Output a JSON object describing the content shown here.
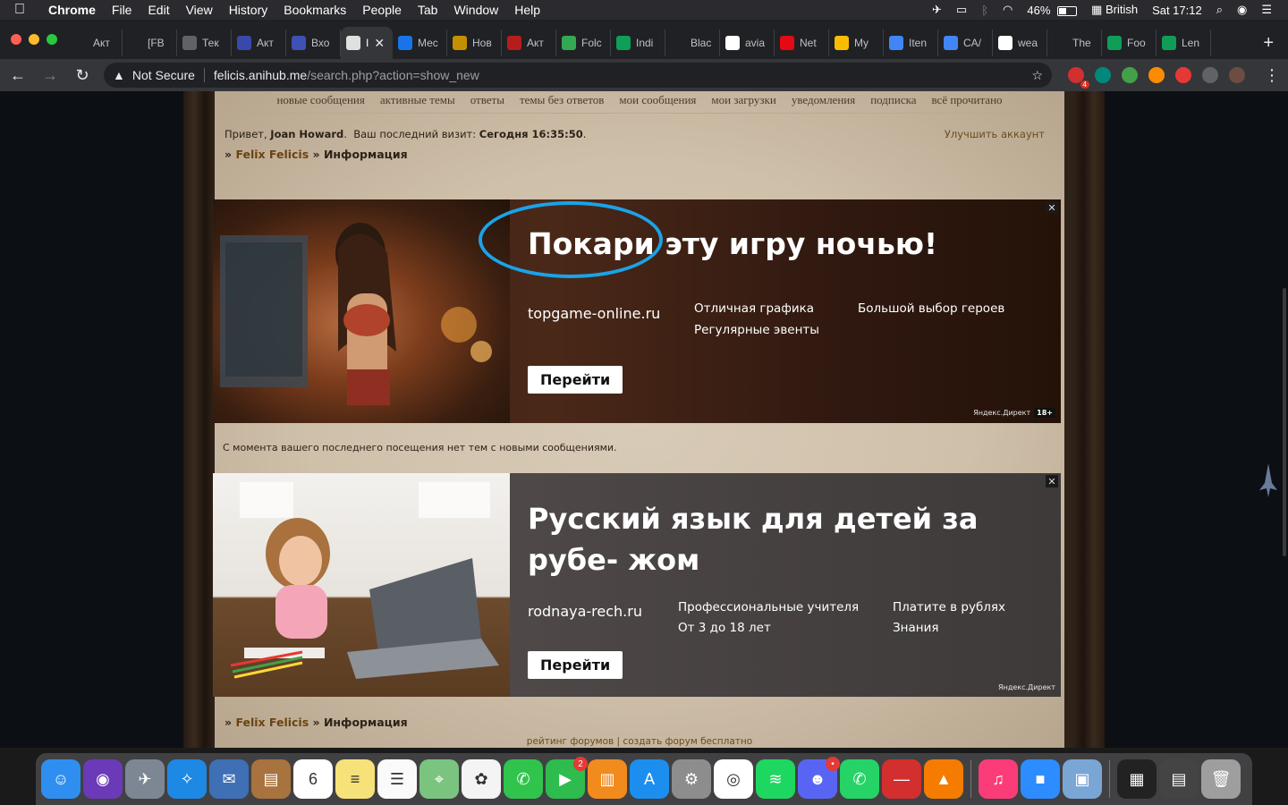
{
  "menubar": {
    "app": "Chrome",
    "items": [
      "File",
      "Edit",
      "View",
      "History",
      "Bookmarks",
      "People",
      "Tab",
      "Window",
      "Help"
    ],
    "battery": "46%",
    "battery_level": 0.46,
    "input_source": "British",
    "clock": "Sat 17:12"
  },
  "tabs": [
    {
      "label": "Акт",
      "icon": "star-icon",
      "color": "#202124"
    },
    {
      "label": "[FB",
      "icon": "star-icon",
      "color": "#202124"
    },
    {
      "label": "Тек",
      "icon": "globe-icon",
      "color": "#5f6368"
    },
    {
      "label": "Акт",
      "icon": "globe-icon",
      "color": "#3949ab"
    },
    {
      "label": "Вхо",
      "icon": "mail-icon",
      "color": "#3f51b5"
    },
    {
      "label": "I",
      "icon": "ghost-icon",
      "color": "#e0e0e0",
      "active": true
    },
    {
      "label": "Мес",
      "icon": "chat-icon",
      "color": "#1a73e8"
    },
    {
      "label": "Нов",
      "icon": "h-icon",
      "color": "#c49000"
    },
    {
      "label": "Акт",
      "icon": "flag-icon",
      "color": "#b71c1c"
    },
    {
      "label": "Folc",
      "icon": "drive-icon",
      "color": "#34a853"
    },
    {
      "label": "Indi",
      "icon": "sheets-icon",
      "color": "#0f9d58"
    },
    {
      "label": "Blac",
      "icon": "moon-icon",
      "color": "#202124"
    },
    {
      "label": "avia",
      "icon": "google-icon",
      "color": "#ffffff"
    },
    {
      "label": "Net",
      "icon": "netflix-icon",
      "color": "#e50914"
    },
    {
      "label": "My",
      "icon": "drive-icon",
      "color": "#fbbc04"
    },
    {
      "label": "Iten",
      "icon": "docs-icon",
      "color": "#4285f4"
    },
    {
      "label": "CA/",
      "icon": "docs-icon",
      "color": "#4285f4"
    },
    {
      "label": "wea",
      "icon": "google-icon",
      "color": "#ffffff"
    },
    {
      "label": "The",
      "icon": "nyt-icon",
      "color": "#202124"
    },
    {
      "label": "Foo",
      "icon": "sheets-icon",
      "color": "#0f9d58"
    },
    {
      "label": "Len",
      "icon": "sheets-icon",
      "color": "#0f9d58"
    }
  ],
  "address": {
    "security": "Not Secure",
    "host": "felicis.anihub.me",
    "path": "/search.php?action=show_new"
  },
  "extensions": [
    {
      "icon": "extension-red-icon",
      "color": "#d32f2f",
      "badge": "4"
    },
    {
      "icon": "extension-e-icon",
      "color": "#00897b",
      "badge": ""
    },
    {
      "icon": "extension-green-icon",
      "color": "#43a047",
      "badge": ""
    },
    {
      "icon": "extension-wrench-icon",
      "color": "#fb8c00",
      "badge": ""
    },
    {
      "icon": "extension-red2-icon",
      "color": "#e53935",
      "badge": ""
    },
    {
      "icon": "puzzle-icon",
      "color": "#5f6368",
      "badge": ""
    },
    {
      "icon": "profile-avatar-icon",
      "color": "#6d4c41",
      "badge": ""
    }
  ],
  "forum": {
    "nav": [
      "новые сообщения",
      "активные темы",
      "ответы",
      "темы без ответов",
      "мои сообщения",
      "мои загрузки",
      "уведомления",
      "подписка",
      "всё прочитано"
    ],
    "greet_prefix": "Привет,",
    "user": "Joan Howard",
    "last_visit_label": "Ваш последний визит:",
    "last_visit": "Сегодня 16:35:50",
    "upgrade": "Улучшить аккаунт",
    "crumb_sep": "»",
    "crumb_forum": "Felix Felicis",
    "crumb_page": "Информация",
    "notice": "С момента вашего последнего посещения нет тем с новыми сообщениями.",
    "footer": "рейтинг форумов | создать форум бесплатно"
  },
  "ad1": {
    "headline": "Покари эту игру ночью!",
    "domain": "topgame-online.ru",
    "features": [
      "Отличная графика",
      "Регулярные эвенты",
      "Большой выбор героев"
    ],
    "button": "Перейти",
    "brand": "Яндекс.Директ",
    "age": "18+"
  },
  "ad2": {
    "headline": "Русский язык для детей за рубе- жом",
    "domain": "rodnaya-rech.ru",
    "features": [
      "Профессиональные учителя",
      "От 3 до 18 лет",
      "Платите в рублях",
      "Знания"
    ],
    "button": "Перейти",
    "brand": "Яндекс.Директ"
  },
  "dock": [
    {
      "name": "finder",
      "color": "#2f8ff0",
      "glyph": "☺"
    },
    {
      "name": "siri",
      "color": "#6a3ab8",
      "glyph": "◉"
    },
    {
      "name": "launchpad",
      "color": "#7d8794",
      "glyph": "✈"
    },
    {
      "name": "safari",
      "color": "#1e88e5",
      "glyph": "✧"
    },
    {
      "name": "mail-stamp",
      "color": "#3f6fb5",
      "glyph": "✉"
    },
    {
      "name": "notebook",
      "color": "#a8733e",
      "glyph": "▤"
    },
    {
      "name": "calendar",
      "color": "#ffffff",
      "glyph": "6"
    },
    {
      "name": "notes",
      "color": "#f7e27a",
      "glyph": "≡"
    },
    {
      "name": "reminders",
      "color": "#fafafa",
      "glyph": "☰"
    },
    {
      "name": "maps",
      "color": "#7bc47f",
      "glyph": "⌖"
    },
    {
      "name": "photos",
      "color": "#f4f4f4",
      "glyph": "✿"
    },
    {
      "name": "messages",
      "color": "#31c44c",
      "glyph": "✆"
    },
    {
      "name": "facetime",
      "color": "#2ebc4e",
      "glyph": "▶",
      "badge": "2"
    },
    {
      "name": "books",
      "color": "#f28b1d",
      "glyph": "▥"
    },
    {
      "name": "app-store",
      "color": "#1c8ef0",
      "glyph": "A"
    },
    {
      "name": "system-preferences",
      "color": "#8d8d8d",
      "glyph": "⚙"
    },
    {
      "name": "chrome",
      "color": "#ffffff",
      "glyph": "◎"
    },
    {
      "name": "spotify",
      "color": "#1ed760",
      "glyph": "≋"
    },
    {
      "name": "discord",
      "color": "#5865f2",
      "glyph": "☻",
      "badge": "•"
    },
    {
      "name": "whatsapp",
      "color": "#25d366",
      "glyph": "✆"
    },
    {
      "name": "stop-app",
      "color": "#d32f2f",
      "glyph": "—"
    },
    {
      "name": "vlc",
      "color": "#f57c00",
      "glyph": "▲"
    },
    {
      "name": "music",
      "color": "#fc3c78",
      "glyph": "♫"
    },
    {
      "name": "zoom",
      "color": "#2d8cff",
      "glyph": "■"
    },
    {
      "name": "preview",
      "color": "#7aa6d6",
      "glyph": "▣"
    },
    {
      "name": "activity-monitor",
      "color": "#222222",
      "glyph": "▦"
    },
    {
      "name": "screenshots-stack",
      "color": "#444444",
      "glyph": "▤"
    },
    {
      "name": "trash",
      "color": "#9e9e9e",
      "glyph": "🗑"
    }
  ]
}
